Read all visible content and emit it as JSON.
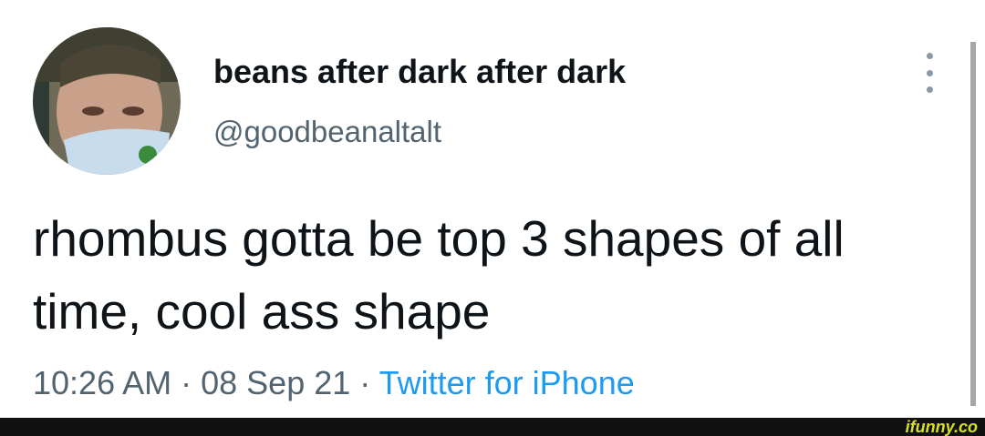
{
  "tweet": {
    "display_name": "beans after dark after dark",
    "handle": "@goodbeanaltalt",
    "text": "rhombus gotta be top 3 shapes of all time, cool ass shape",
    "time": "10:26 AM",
    "separator": " · ",
    "date": "08 Sep 21",
    "source": "Twitter for iPhone"
  },
  "icons": {
    "more": "more-options-icon",
    "avatar": "profile-avatar"
  },
  "watermark": "ifunny.co",
  "colors": {
    "text": "#0f1419",
    "secondary": "#536471",
    "link": "#1d9bf0",
    "footer": "#111111",
    "watermark": "#d9e021"
  }
}
